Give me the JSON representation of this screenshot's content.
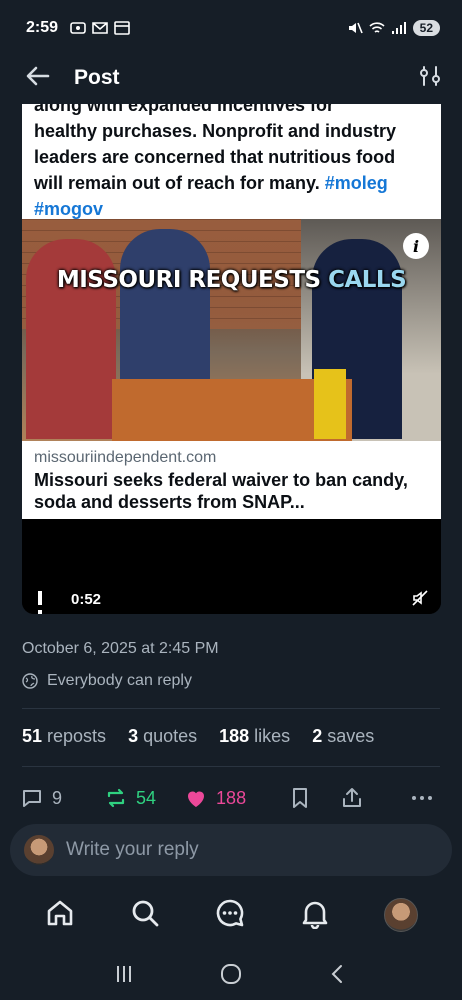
{
  "status_bar": {
    "time": "2:59",
    "battery": "52"
  },
  "header": {
    "title": "Post"
  },
  "embed": {
    "post_text_cut": "along with expanded incentives for",
    "post_text": "healthy purchases. Nonprofit and industry leaders are concerned that nutritious food will remain out of reach for many.",
    "hashtag1": "#moleg",
    "hashtag2": "#mogov",
    "video_caption_main": "MISSOURI REQUESTS",
    "video_caption_highlight": "CALLS",
    "info_label": "i",
    "link_domain": "missouriindependent.com",
    "link_title": "Missouri seeks federal waiver to ban candy, soda and desserts from SNAP...",
    "video_time": "0:52"
  },
  "meta": {
    "date": "October 6, 2025 at 2:45 PM",
    "reply_permission": "Everybody can reply"
  },
  "stats": {
    "reposts_count": "51",
    "reposts_label": "reposts",
    "quotes_count": "3",
    "quotes_label": "quotes",
    "likes_count": "188",
    "likes_label": "likes",
    "saves_count": "2",
    "saves_label": "saves"
  },
  "actions": {
    "replies": "9",
    "reposts": "54",
    "likes": "188"
  },
  "composer": {
    "placeholder": "Write your reply"
  },
  "colors": {
    "background": "#161e27",
    "accent_link": "#1577d6",
    "repost_green": "#2fd180",
    "like_pink": "#ec4899"
  }
}
